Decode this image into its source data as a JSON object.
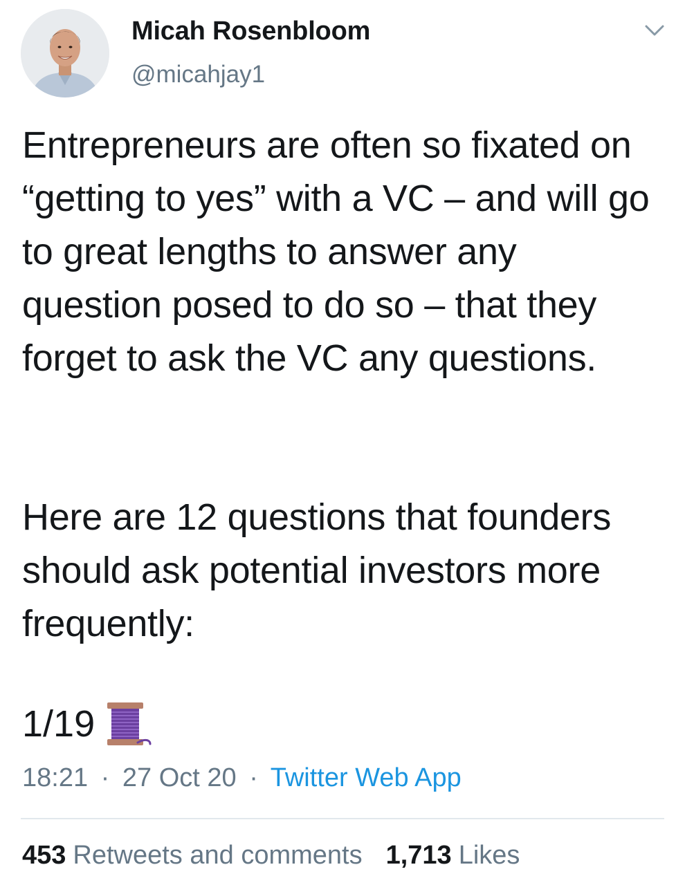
{
  "author": {
    "name": "Micah Rosenbloom",
    "handle": "@micahjay1"
  },
  "icons": {
    "menu": "chevron-down-icon",
    "thread": "spool-of-thread-emoji"
  },
  "tweet": {
    "paragraph1": "Entrepreneurs are often so fixated on “getting to yes” with a VC – and will go to great lengths to answer any question posed to do so – that they forget to ask the VC any questions.",
    "paragraph2": "Here are 12 questions that founders should ask potential investors more frequently:",
    "thread_counter": "1/19"
  },
  "meta": {
    "time": "18:21",
    "date": "27 Oct 20",
    "separator": "·",
    "source": "Twitter Web App"
  },
  "stats": {
    "retweets_count": "453",
    "retweets_label": "Retweets and comments",
    "likes_count": "1,713",
    "likes_label": "Likes"
  },
  "colors": {
    "text": "#14171a",
    "secondary": "#657786",
    "link": "#1b95e0",
    "divider": "#e1e8ed"
  }
}
